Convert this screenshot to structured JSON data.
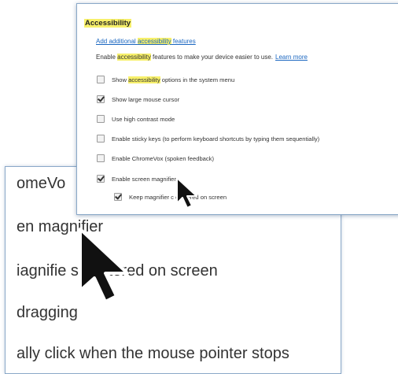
{
  "zoomed_view": {
    "lines": [
      "omeVo",
      "en magnifier",
      "iagnifie     s centered on screen",
      "dragging",
      "ally click when the mouse pointer stops"
    ]
  },
  "settings": {
    "title": "Accessibility",
    "link": "Add additional accessibility features",
    "description": "Enable accessibility features to make your device easier to use.",
    "learn_more": "Learn more",
    "options": [
      {
        "label": "Show accessibility options in the system menu",
        "checked": false
      },
      {
        "label": "Show large mouse cursor",
        "checked": true
      },
      {
        "label": "Use high contrast mode",
        "checked": false
      },
      {
        "label": "Enable sticky keys (to perform keyboard shortcuts by typing them sequentially)",
        "checked": false
      },
      {
        "label": "Enable ChromeVox (spoken feedback)",
        "checked": false
      },
      {
        "label": "Enable screen magnifier",
        "checked": true
      },
      {
        "label": "Keep magnifier    c centered on screen",
        "checked": true
      }
    ]
  },
  "icons": {
    "cursor": "mouse-pointer-icon",
    "checkbox": "checkbox-icon"
  },
  "colors": {
    "highlight": "#f7f06a",
    "link": "#1a66c0",
    "panel_border": "#8aa8c8"
  }
}
